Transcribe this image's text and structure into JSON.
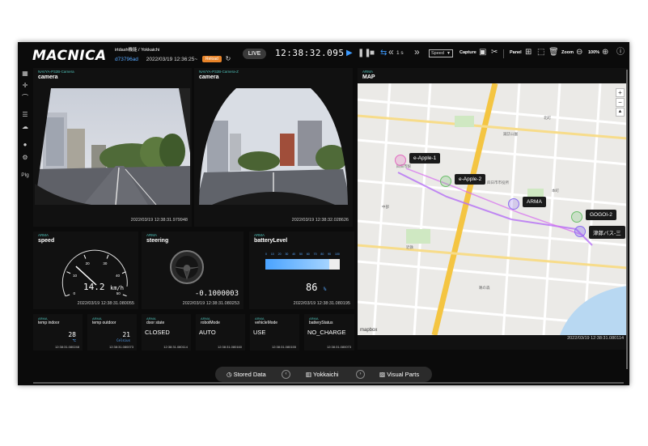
{
  "header": {
    "logo": "MACNICA",
    "breadcrumb": "irtdash機能 / Yokkaichi",
    "user_id": "d73796ad",
    "datetime": "2022/03/19 12:36:25~",
    "reload_label": "Reload",
    "live_label": "LIVE",
    "clock": "12:38:32.095",
    "step_label": "1 s",
    "speed_label": "Speed",
    "capture_label": "Capture",
    "panel_label": "Panel",
    "zoom_label": "Zoom",
    "zoom_value": "100%"
  },
  "sidebar": {
    "plg_label": "Plg"
  },
  "cameras": [
    {
      "tag": "NAVYA-P32B-Camera",
      "title": "camera",
      "timestamp": "2022/03/19 12:38:31.979948"
    },
    {
      "tag": "NAVYA-P32B-Camera-Z",
      "title": "camera",
      "timestamp": "2022/03/19 12:38:32.028626"
    }
  ],
  "map": {
    "tag": "ARMA",
    "title": "MAP",
    "timestamp": "2022/03/19 12:38:31.080114",
    "attribution": "mapbox",
    "vehicles": [
      "e-Apple-1",
      "e-Apple-2",
      "ARMA",
      "GOGOI-2",
      "津郎バス-三"
    ],
    "place_labels": [
      "四日市市役所",
      "四日市駅",
      "諏訪公園",
      "中部",
      "近鉄",
      "本町",
      "北町",
      "鵜の森"
    ]
  },
  "speed": {
    "tag": "ARMA",
    "title": "speed",
    "value": "14.2",
    "unit": "km/h",
    "value_numeric": 14.2,
    "ticks": [
      "0",
      "10",
      "20",
      "30",
      "40",
      "50"
    ],
    "timestamp": "2022/03/19 12:38:31.080055"
  },
  "steering": {
    "tag": "ARMA",
    "title": "steering",
    "value": "-0.1000003",
    "timestamp": "2022/03/19 12:38:31.080253"
  },
  "battery": {
    "tag": "ARMA",
    "title": "batteryLevel",
    "value": "86",
    "unit": "%",
    "level": 0.86,
    "scale": [
      "0",
      "10",
      "20",
      "30",
      "40",
      "50",
      "60",
      "70",
      "80",
      "90",
      "100"
    ],
    "timestamp": "2022/03/19 12:38:31.080195"
  },
  "small_panels": [
    {
      "tag": "ARMA",
      "title": "temp indoor",
      "value": "28",
      "sub": "℃",
      "timestamp": "12:38:31.080248"
    },
    {
      "tag": "ARMA",
      "title": "temp outdoor",
      "value": "21",
      "sub": "Celsius",
      "timestamp": "12:38:31.080073"
    },
    {
      "tag": "ARMA",
      "title": "door state",
      "value": "CLOSED",
      "timestamp": "12:38:31.080114"
    },
    {
      "tag": "ARMA",
      "title": "robotMode",
      "value": "AUTO",
      "timestamp": "12:38:31.080160"
    },
    {
      "tag": "ARMA",
      "title": "vehicleMode",
      "value": "USE",
      "timestamp": "12:38:31.080155"
    },
    {
      "tag": "ARMA",
      "title": "batteryStatus",
      "value": "NO_CHARGE",
      "timestamp": "12:38:31.080073"
    }
  ],
  "bottom": {
    "stored_data": "Stored Data",
    "location": "Yokkaichi",
    "visual_parts": "Visual Parts"
  },
  "colors": {
    "accent_blue": "#3d9bff",
    "teal_tag": "#4fc0b8",
    "reload_orange": "#e8842a",
    "route_purple": "#a64dff"
  }
}
